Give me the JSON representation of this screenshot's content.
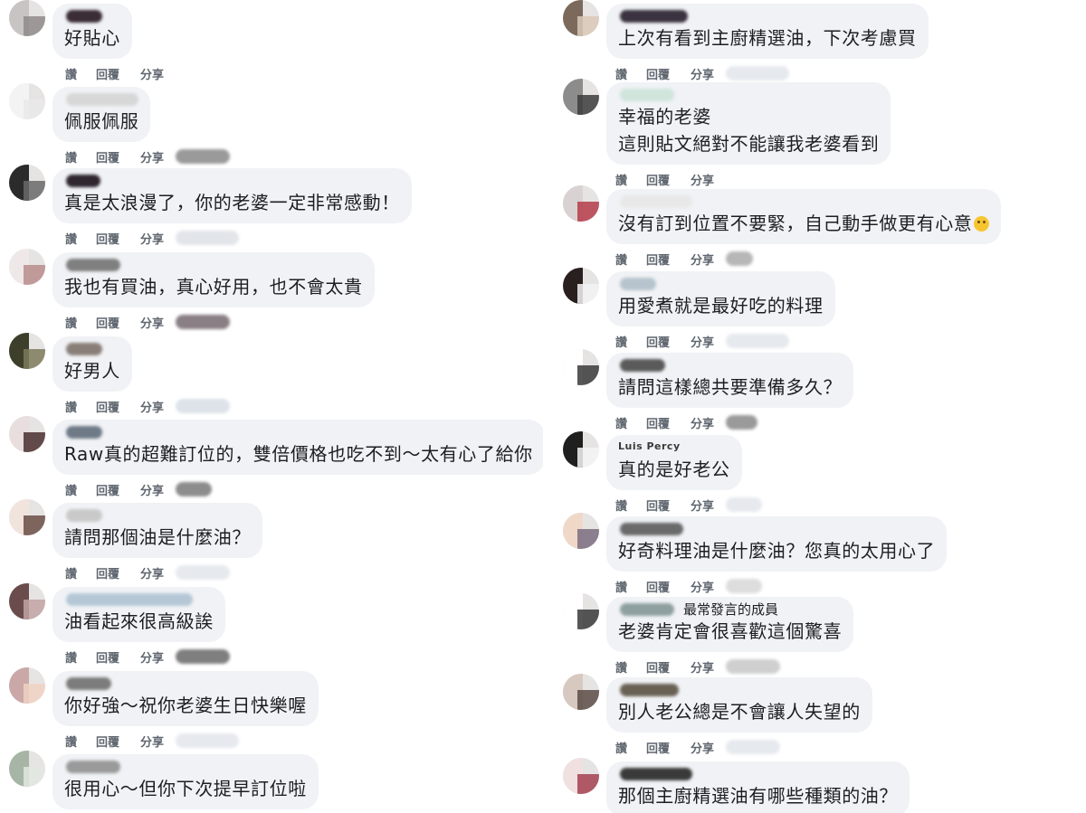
{
  "labels": {
    "like": "讚",
    "reply": "回覆",
    "share": "分享"
  },
  "badge": "最常發言的成員",
  "partial_author_names": [
    "Luis Percy"
  ],
  "colors": {
    "bubble": "#f0f2f5",
    "text": "#1c1e21",
    "action": "#606770",
    "emoji": "#f7c531"
  },
  "left_comments": [
    {
      "text": "好貼心",
      "emoji": ""
    },
    {
      "text": "佩服佩服",
      "emoji": ""
    },
    {
      "text": "真是太浪漫了，你的老婆一定非常感動！",
      "emoji": ""
    },
    {
      "text": "我也有買油，真心好用，也不會太貴",
      "emoji": ""
    },
    {
      "text": "好男人",
      "emoji": ""
    },
    {
      "text": "Raw真的超難訂位的，雙倍價格也吃不到～太有心了給你",
      "emoji": ""
    },
    {
      "text": "請問那個油是什麼油？",
      "emoji": ""
    },
    {
      "text": "油看起來很高級誒",
      "emoji": ""
    },
    {
      "text": "你好強～祝你老婆生日快樂喔",
      "emoji": ""
    },
    {
      "text": "很用心～但你下次提早訂位啦",
      "emoji": ""
    }
  ],
  "right_comments": [
    {
      "text": "上次有看到主廚精選油，下次考慮買",
      "emoji": ""
    },
    {
      "text": "幸福的老婆",
      "text2": "這則貼文絕對不能讓我老婆看到",
      "emoji": ""
    },
    {
      "text": "沒有訂到位置不要緊，自己動手做更有心意",
      "emoji": "smiling-face-emoji"
    },
    {
      "text": "用愛煮就是最好吃的料理",
      "emoji": ""
    },
    {
      "text": "請問這樣總共要準備多久？",
      "emoji": ""
    },
    {
      "text": "真的是好老公",
      "emoji": ""
    },
    {
      "text": "好奇料理油是什麼油？您真的太用心了",
      "emoji": ""
    },
    {
      "text": "老婆肯定會很喜歡這個驚喜",
      "emoji": ""
    },
    {
      "text": "別人老公總是不會讓人失望的",
      "emoji": ""
    },
    {
      "text": "那個主廚精選油有哪些種類的油？",
      "emoji": ""
    }
  ]
}
